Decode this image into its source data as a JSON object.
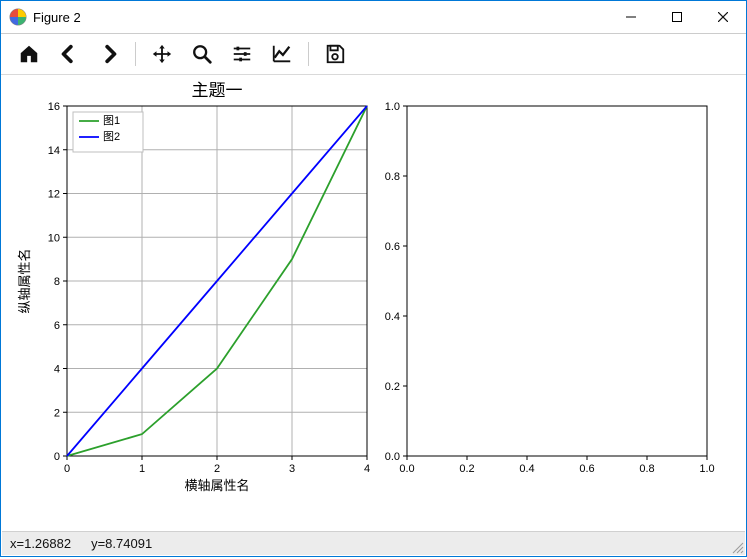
{
  "window": {
    "title": "Figure 2"
  },
  "toolbar": {
    "home": "home-icon",
    "back": "arrow-left-icon",
    "forward": "arrow-right-icon",
    "pan": "move-icon",
    "zoom": "zoom-icon",
    "subplots": "sliders-icon",
    "edit": "chart-line-icon",
    "save": "save-icon"
  },
  "status": {
    "x_label": "x=1.26882",
    "y_label": "y=8.74091"
  },
  "chart_data": [
    {
      "type": "line",
      "title": "主题一",
      "xlabel": "横轴属性名",
      "ylabel": "纵轴属性名",
      "xlim": [
        0,
        4
      ],
      "ylim": [
        0,
        16
      ],
      "xticks": [
        0,
        1,
        2,
        3,
        4
      ],
      "yticks": [
        0,
        2,
        4,
        6,
        8,
        10,
        12,
        14,
        16
      ],
      "grid": true,
      "legend": {
        "position": "upper left",
        "entries": [
          "图1",
          "图2"
        ]
      },
      "series": [
        {
          "name": "图1",
          "color": "#2ca02c",
          "x": [
            0,
            1,
            2,
            3,
            4
          ],
          "y": [
            0,
            1,
            4,
            9,
            16
          ]
        },
        {
          "name": "图2",
          "color": "#0000ff",
          "x": [
            0,
            1,
            2,
            3,
            4
          ],
          "y": [
            0,
            4,
            8,
            12,
            16
          ]
        }
      ]
    },
    {
      "type": "line",
      "title": "",
      "xlabel": "",
      "ylabel": "",
      "xlim": [
        0.0,
        1.0
      ],
      "ylim": [
        0.0,
        1.0
      ],
      "xticks": [
        0.0,
        0.2,
        0.4,
        0.6,
        0.8,
        1.0
      ],
      "yticks": [
        0.0,
        0.2,
        0.4,
        0.6,
        0.8,
        1.0
      ],
      "grid": false,
      "series": []
    }
  ]
}
